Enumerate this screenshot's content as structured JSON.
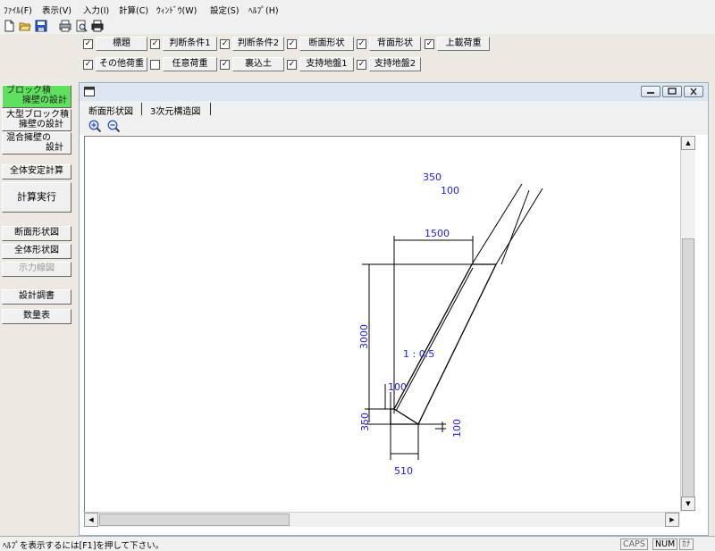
{
  "menubar": {
    "items": [
      "ﾌｧｲﾙ(F)",
      "表示(V)",
      "入力(I)",
      "計算(C)",
      "ｳｨﾝﾄﾞｳ(W)",
      "設定(S)",
      "ﾍﾙﾌﾟ(H)"
    ]
  },
  "checkbar": {
    "row1": [
      {
        "label": "標題",
        "checked": true
      },
      {
        "label": "判断条件1",
        "checked": true
      },
      {
        "label": "判断条件2",
        "checked": true
      },
      {
        "label": "断面形状",
        "checked": true
      },
      {
        "label": "背面形状",
        "checked": true
      },
      {
        "label": "上載荷重",
        "checked": true
      }
    ],
    "row2": [
      {
        "label": "その他荷重",
        "checked": true
      },
      {
        "label": "任意荷重",
        "checked": false
      },
      {
        "label": "裏込土",
        "checked": true
      },
      {
        "label": "支持地盤1",
        "checked": true
      },
      {
        "label": "支持地盤2",
        "checked": true
      }
    ]
  },
  "leftpanel": {
    "design1": {
      "line1": "ブロック積",
      "line2": "擁壁の設計"
    },
    "design2": {
      "line1": "大型ブロック積",
      "line2": "擁壁の設計"
    },
    "design3": {
      "line1": "混合擁壁の",
      "line2": "設計"
    },
    "stability": "全体安定計算",
    "run": "計算実行",
    "section_view": "断面形状図",
    "overall_view": "全体形状図",
    "force_view": "示力線図",
    "report": "設計調書",
    "quantity": "数量表"
  },
  "childwindow": {
    "tabs": [
      "断面形状図",
      "3次元構造図"
    ]
  },
  "drawing": {
    "dim_top1": "350",
    "dim_top2": "100",
    "dim_width": "1500",
    "dim_height": "3000",
    "slope": "1 : 0.5",
    "dim_100a": "100",
    "dim_350": "350",
    "dim_100b": "100",
    "dim_base": "510",
    "color_dim": "#1a1aff"
  },
  "statusbar": {
    "help": "ﾍﾙﾌﾟを表示するには[F1]を押して下さい。",
    "caps": "CAPS",
    "num": "NUM",
    "kana": "ｶﾅ"
  }
}
